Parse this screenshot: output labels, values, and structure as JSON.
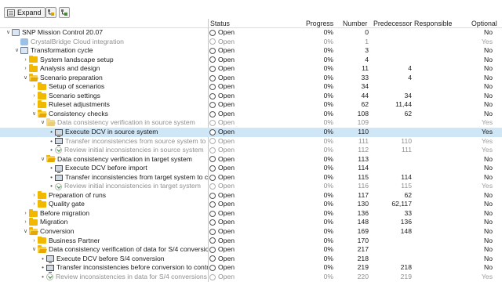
{
  "toolbar": {
    "expand_label": "Expand",
    "icons": [
      "tree-expand-icon",
      "tree-collapse-icon"
    ]
  },
  "columns": {
    "status": "Status",
    "progress": "Progress",
    "number": "Number",
    "predecessor": "Predecessor",
    "responsible": "Responsible",
    "optional": "Optional"
  },
  "rows": [
    {
      "indent": 0,
      "toggle": "open",
      "icon": "project",
      "name": "SNP Mission Control 20.07",
      "status": "Open",
      "progress": "0%",
      "number": "0",
      "predecessor": "",
      "optional": "No",
      "dim": false,
      "sel": false
    },
    {
      "indent": 1,
      "toggle": "",
      "icon": "cloud",
      "name": "CrystalBridge Cloud integration",
      "status": "Open",
      "progress": "0%",
      "number": "1",
      "predecessor": "",
      "optional": "Yes",
      "dim": true,
      "sel": false
    },
    {
      "indent": 1,
      "toggle": "open",
      "icon": "phase",
      "name": "Transformation cycle",
      "status": "Open",
      "progress": "0%",
      "number": "3",
      "predecessor": "",
      "optional": "No",
      "dim": false,
      "sel": false
    },
    {
      "indent": 2,
      "toggle": "closed",
      "icon": "folder",
      "name": "System landscape setup",
      "status": "Open",
      "progress": "0%",
      "number": "4",
      "predecessor": "",
      "optional": "No",
      "dim": false,
      "sel": false
    },
    {
      "indent": 2,
      "toggle": "closed",
      "icon": "folder",
      "name": "Analysis and design",
      "status": "Open",
      "progress": "0%",
      "number": "11",
      "predecessor": "4",
      "optional": "No",
      "dim": false,
      "sel": false
    },
    {
      "indent": 2,
      "toggle": "open",
      "icon": "folder-open",
      "name": "Scenario preparation",
      "status": "Open",
      "progress": "0%",
      "number": "33",
      "predecessor": "4",
      "optional": "No",
      "dim": false,
      "sel": false
    },
    {
      "indent": 3,
      "toggle": "closed",
      "icon": "folder",
      "name": "Setup of scenarios",
      "status": "Open",
      "progress": "0%",
      "number": "34",
      "predecessor": "",
      "optional": "No",
      "dim": false,
      "sel": false
    },
    {
      "indent": 3,
      "toggle": "closed",
      "icon": "folder",
      "name": "Scenario settings",
      "status": "Open",
      "progress": "0%",
      "number": "44",
      "predecessor": "34",
      "optional": "No",
      "dim": false,
      "sel": false
    },
    {
      "indent": 3,
      "toggle": "closed",
      "icon": "folder",
      "name": "Ruleset adjustments",
      "status": "Open",
      "progress": "0%",
      "number": "62",
      "predecessor": "11,44",
      "optional": "No",
      "dim": false,
      "sel": false
    },
    {
      "indent": 3,
      "toggle": "open",
      "icon": "folder-open",
      "name": "Consistency checks",
      "status": "Open",
      "progress": "0%",
      "number": "108",
      "predecessor": "62",
      "optional": "No",
      "dim": false,
      "sel": false
    },
    {
      "indent": 4,
      "toggle": "open",
      "icon": "folder-open",
      "name": "Data consistency verification in source system",
      "status": "Open",
      "progress": "0%",
      "number": "109",
      "predecessor": "",
      "optional": "Yes",
      "dim": true,
      "sel": false
    },
    {
      "indent": 5,
      "toggle": "dot",
      "icon": "monitor",
      "name": "Execute DCV in source system",
      "status": "Open",
      "progress": "0%",
      "number": "110",
      "predecessor": "",
      "optional": "Yes",
      "dim": false,
      "sel": true
    },
    {
      "indent": 5,
      "toggle": "dot",
      "icon": "monitor",
      "name": "Transfer inconsistencies from source system to control",
      "status": "Open",
      "progress": "0%",
      "number": "111",
      "predecessor": "110",
      "optional": "Yes",
      "dim": true,
      "sel": false
    },
    {
      "indent": 5,
      "toggle": "dot",
      "icon": "check",
      "name": "Review initial inconsistencies in source system",
      "status": "Open",
      "progress": "0%",
      "number": "112",
      "predecessor": "111",
      "optional": "Yes",
      "dim": true,
      "sel": false
    },
    {
      "indent": 4,
      "toggle": "open",
      "icon": "folder-open",
      "name": "Data consistency verification in target system",
      "status": "Open",
      "progress": "0%",
      "number": "113",
      "predecessor": "",
      "optional": "No",
      "dim": false,
      "sel": false
    },
    {
      "indent": 5,
      "toggle": "dot",
      "icon": "monitor",
      "name": "Execute DCV before import",
      "status": "Open",
      "progress": "0%",
      "number": "114",
      "predecessor": "",
      "optional": "No",
      "dim": false,
      "sel": false
    },
    {
      "indent": 5,
      "toggle": "dot",
      "icon": "monitor",
      "name": "Transfer inconsistencies from target system to control",
      "status": "Open",
      "progress": "0%",
      "number": "115",
      "predecessor": "114",
      "optional": "No",
      "dim": false,
      "sel": false
    },
    {
      "indent": 5,
      "toggle": "dot",
      "icon": "check",
      "name": "Review initial inconsistencies in target system",
      "status": "Open",
      "progress": "0%",
      "number": "116",
      "predecessor": "115",
      "optional": "Yes",
      "dim": true,
      "sel": false
    },
    {
      "indent": 3,
      "toggle": "closed",
      "icon": "folder",
      "name": "Preparation of runs",
      "status": "Open",
      "progress": "0%",
      "number": "117",
      "predecessor": "62",
      "optional": "No",
      "dim": false,
      "sel": false
    },
    {
      "indent": 3,
      "toggle": "closed",
      "icon": "folder",
      "name": "Quality gate",
      "status": "Open",
      "progress": "0%",
      "number": "130",
      "predecessor": "62,117",
      "optional": "No",
      "dim": false,
      "sel": false
    },
    {
      "indent": 2,
      "toggle": "closed",
      "icon": "folder",
      "name": "Before migration",
      "status": "Open",
      "progress": "0%",
      "number": "136",
      "predecessor": "33",
      "optional": "No",
      "dim": false,
      "sel": false
    },
    {
      "indent": 2,
      "toggle": "closed",
      "icon": "folder",
      "name": "Migration",
      "status": "Open",
      "progress": "0%",
      "number": "148",
      "predecessor": "136",
      "optional": "No",
      "dim": false,
      "sel": false
    },
    {
      "indent": 2,
      "toggle": "open",
      "icon": "folder-open",
      "name": "Conversion",
      "status": "Open",
      "progress": "0%",
      "number": "169",
      "predecessor": "148",
      "optional": "No",
      "dim": false,
      "sel": false
    },
    {
      "indent": 3,
      "toggle": "closed",
      "icon": "folder",
      "name": "Business Partner",
      "status": "Open",
      "progress": "0%",
      "number": "170",
      "predecessor": "",
      "optional": "No",
      "dim": false,
      "sel": false
    },
    {
      "indent": 3,
      "toggle": "open",
      "icon": "folder-open",
      "name": "Data consistency verification of data for S/4 conversion",
      "status": "Open",
      "progress": "0%",
      "number": "217",
      "predecessor": "",
      "optional": "No",
      "dim": false,
      "sel": false
    },
    {
      "indent": 4,
      "toggle": "dot",
      "icon": "monitor",
      "name": "Execute DCV before S/4 conversion",
      "status": "Open",
      "progress": "0%",
      "number": "218",
      "predecessor": "",
      "optional": "No",
      "dim": false,
      "sel": false
    },
    {
      "indent": 4,
      "toggle": "dot",
      "icon": "monitor",
      "name": "Transfer inconsistencies before conversion to control",
      "status": "Open",
      "progress": "0%",
      "number": "219",
      "predecessor": "218",
      "optional": "No",
      "dim": false,
      "sel": false
    },
    {
      "indent": 4,
      "toggle": "dot",
      "icon": "check",
      "name": "Review inconsistencies in data for S/4 conversions",
      "status": "Open",
      "progress": "0%",
      "number": "220",
      "predecessor": "219",
      "optional": "Yes",
      "dim": true,
      "sel": false
    }
  ]
}
